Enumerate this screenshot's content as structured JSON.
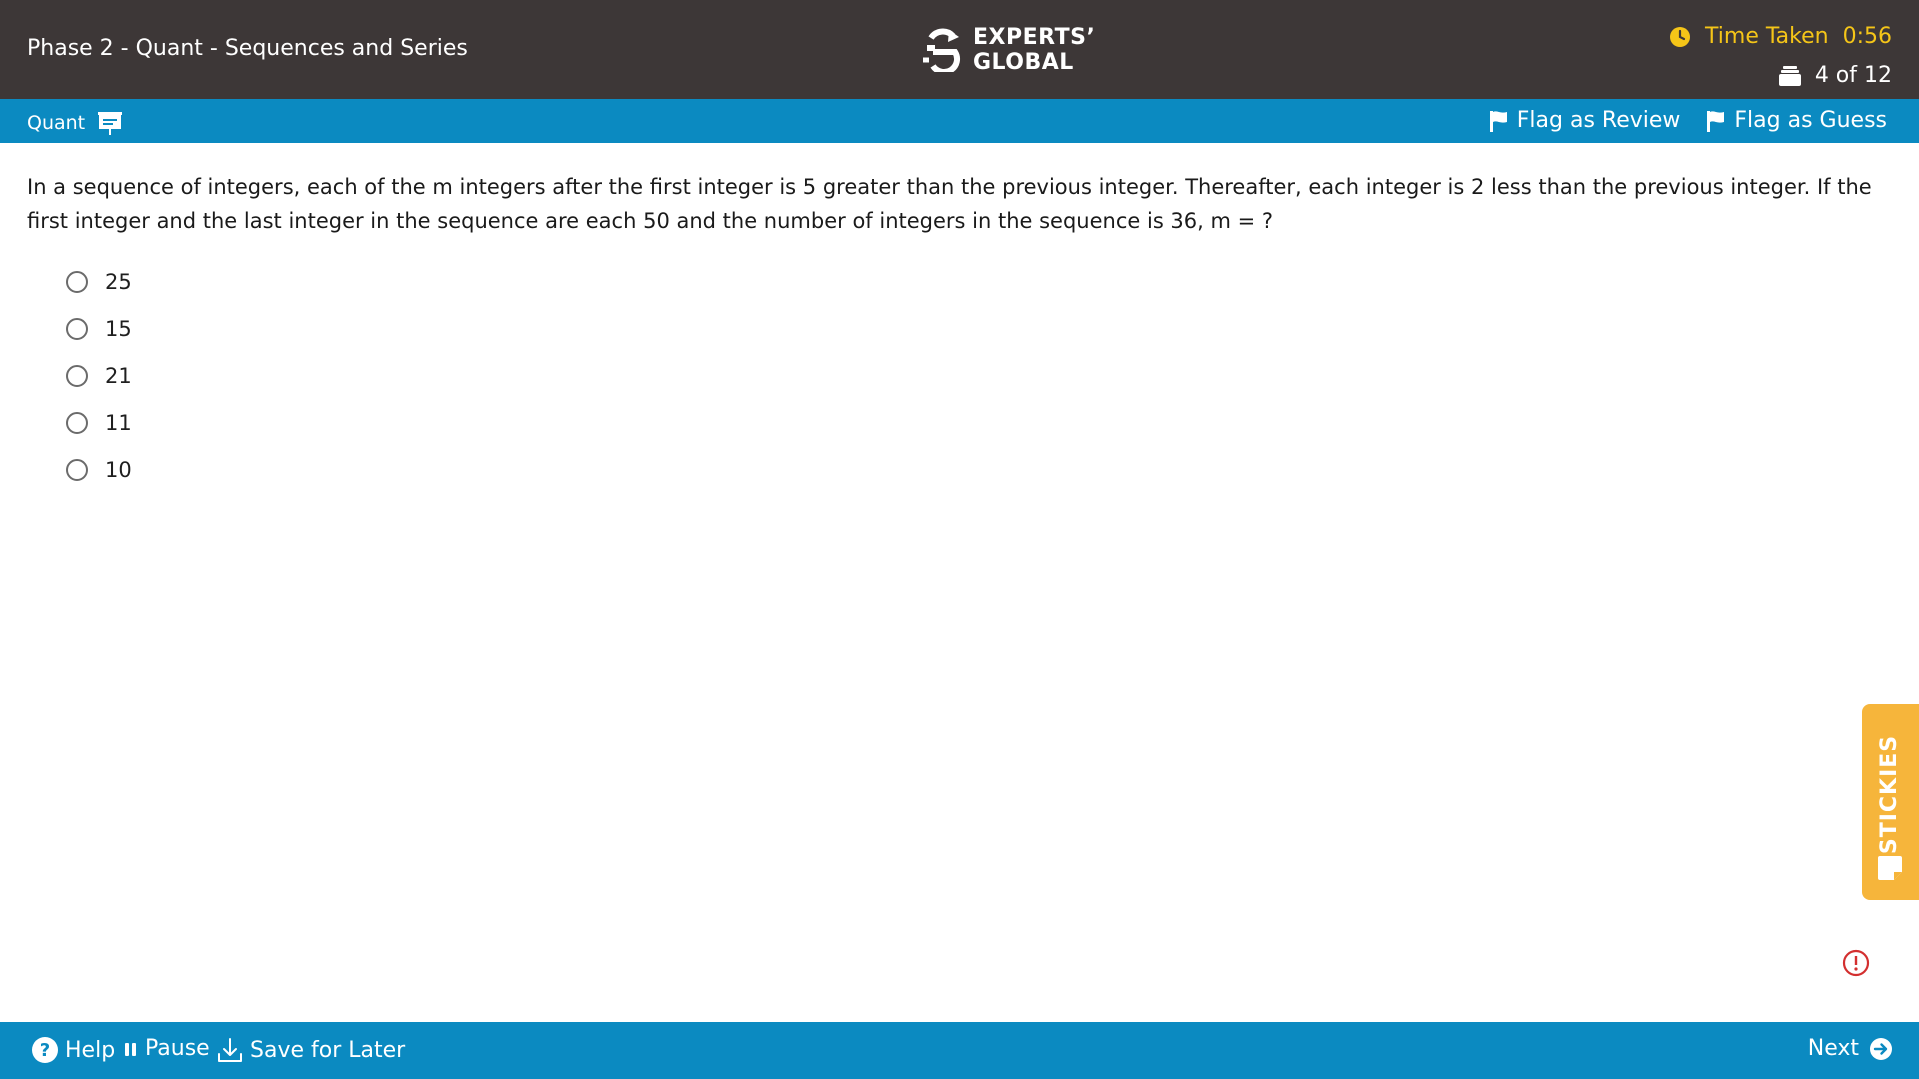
{
  "header": {
    "title": "Phase 2 - Quant - Sequences and Series",
    "logo_line1": "EXPERTS’",
    "logo_line2": "GLOBAL",
    "timer_label": "Time Taken",
    "timer_value": "0:56",
    "progress": "4 of 12"
  },
  "subheader": {
    "section": "Quant",
    "flag_review": "Flag as Review",
    "flag_guess": "Flag as Guess"
  },
  "question": {
    "text": "In a sequence of integers, each of the m integers after the first integer is 5 greater than the previous integer. Thereafter, each integer is 2 less than the previous integer. If the first integer and the last integer in the sequence are each 50 and the number of integers in the sequence is 36, m = ?",
    "options": [
      "25",
      "15",
      "21",
      "11",
      "10"
    ]
  },
  "stickies": {
    "label": "STICKIES"
  },
  "footer": {
    "help": "Help",
    "pause": "Pause",
    "save": "Save for Later",
    "next": "Next"
  },
  "colors": {
    "header_bg": "#3d3737",
    "accent_blue": "#0b8ac1",
    "timer_yellow": "#f5c518",
    "stickies_orange": "#f6b53b",
    "alert_red": "#d32f2f"
  }
}
